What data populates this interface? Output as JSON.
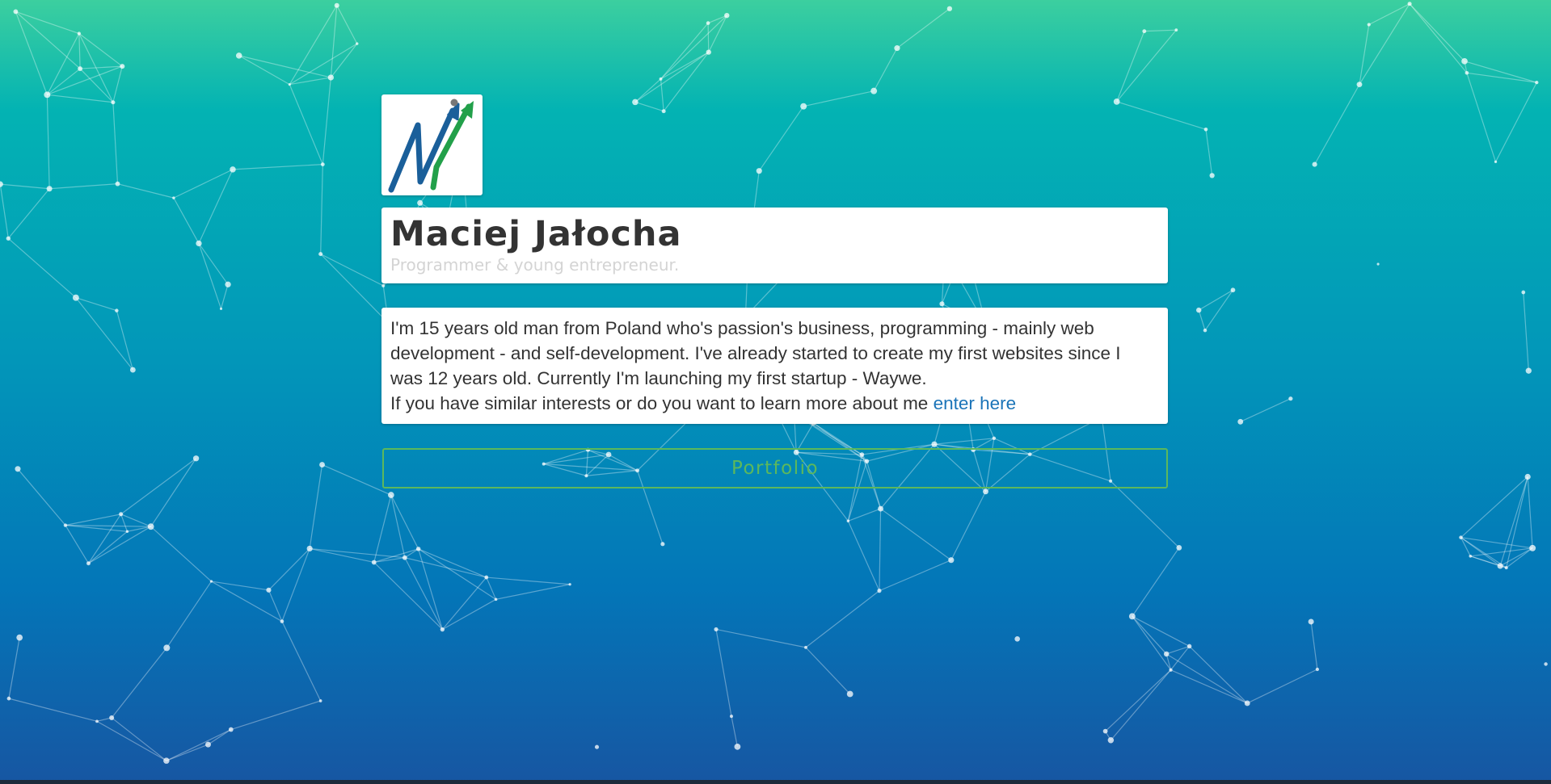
{
  "profile": {
    "name": "Maciej Jałocha",
    "subtitle": "Programmer & young entrepreneur."
  },
  "bio": {
    "lines": [
      "I'm 15 years old man from Poland who's passion's business, programming - mainly web",
      "development - and self-development. I've already started to create my first websites since I",
      "was 12 years old. Currently I'm launching my first startup - Waywe."
    ],
    "cta_text": "If you have similar interests or do you want to learn more about me",
    "cta_link": "enter here"
  },
  "portfolio_label": "Portfolio",
  "colors": {
    "accent_green": "#5cb85c",
    "link_blue": "#1b74b8",
    "logo_blue": "#1a5f9a",
    "logo_green": "#22a04a"
  },
  "icons": {
    "logo": "mj-logo-icon"
  }
}
